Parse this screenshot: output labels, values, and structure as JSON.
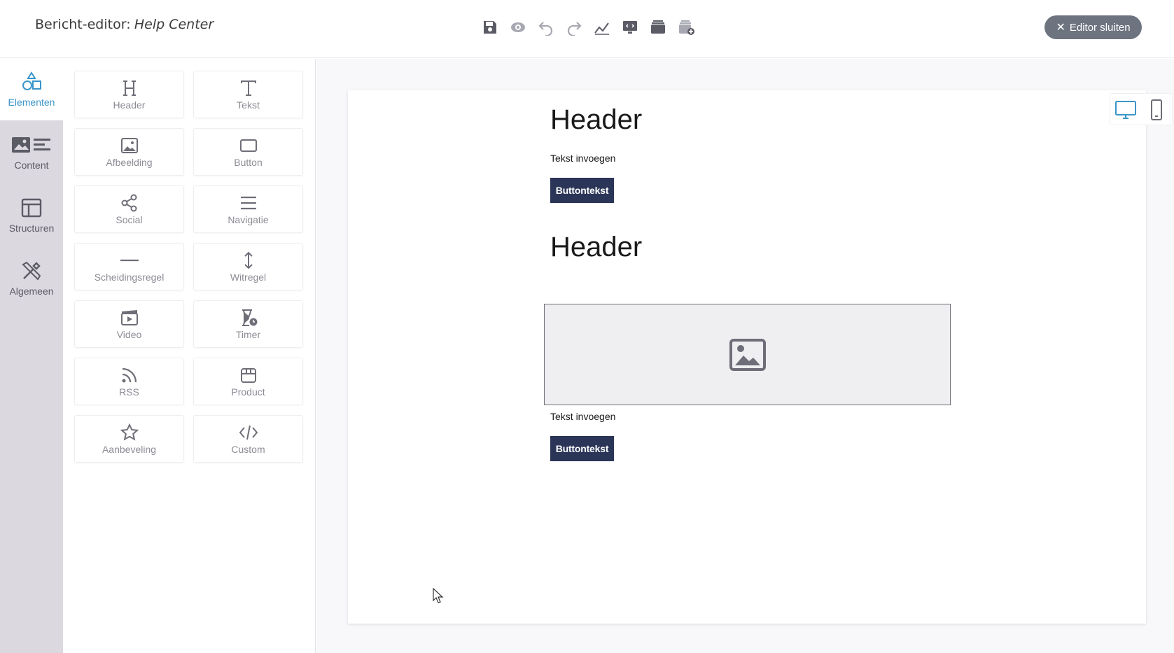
{
  "header": {
    "title_prefix": "Bericht-editor:",
    "title_name": "Help Center",
    "close_label": "Editor sluiten",
    "toolbar_icons": [
      "save-icon",
      "preview-icon",
      "undo-icon",
      "redo-icon",
      "analytics-icon",
      "screen-preview-icon",
      "layers-icon",
      "add-layer-icon"
    ]
  },
  "rail": {
    "items": [
      {
        "label": "Elementen",
        "icon": "shapes-icon",
        "active": true
      },
      {
        "label": "Content",
        "icon": "content-icon",
        "active": false
      },
      {
        "label": "Structuren",
        "icon": "layout-icon",
        "active": false
      },
      {
        "label": "Algemeen",
        "icon": "tools-icon",
        "active": false
      }
    ]
  },
  "elements": {
    "tiles": [
      {
        "label": "Header",
        "icon": "header-icon"
      },
      {
        "label": "Tekst",
        "icon": "text-icon"
      },
      {
        "label": "Afbeelding",
        "icon": "image-icon"
      },
      {
        "label": "Button",
        "icon": "button-icon"
      },
      {
        "label": "Social",
        "icon": "share-icon"
      },
      {
        "label": "Navigatie",
        "icon": "menu-icon"
      },
      {
        "label": "Scheidingsregel",
        "icon": "divider-icon"
      },
      {
        "label": "Witregel",
        "icon": "spacer-icon"
      },
      {
        "label": "Video",
        "icon": "video-icon"
      },
      {
        "label": "Timer",
        "icon": "timer-icon"
      },
      {
        "label": "RSS",
        "icon": "rss-icon"
      },
      {
        "label": "Product",
        "icon": "product-icon"
      },
      {
        "label": "Aanbeveling",
        "icon": "star-icon"
      },
      {
        "label": "Custom",
        "icon": "code-icon"
      }
    ]
  },
  "email": {
    "block1": {
      "header": "Header",
      "text": "Tekst invoegen",
      "button": "Buttontekst"
    },
    "block2": {
      "header": "Header",
      "text": "Tekst invoegen",
      "button": "Buttontekst"
    }
  },
  "colors": {
    "accent": "#3a95c9",
    "button_dark": "#2b3558",
    "close_button": "#6d7480",
    "rail_bg": "#dcd8df"
  }
}
